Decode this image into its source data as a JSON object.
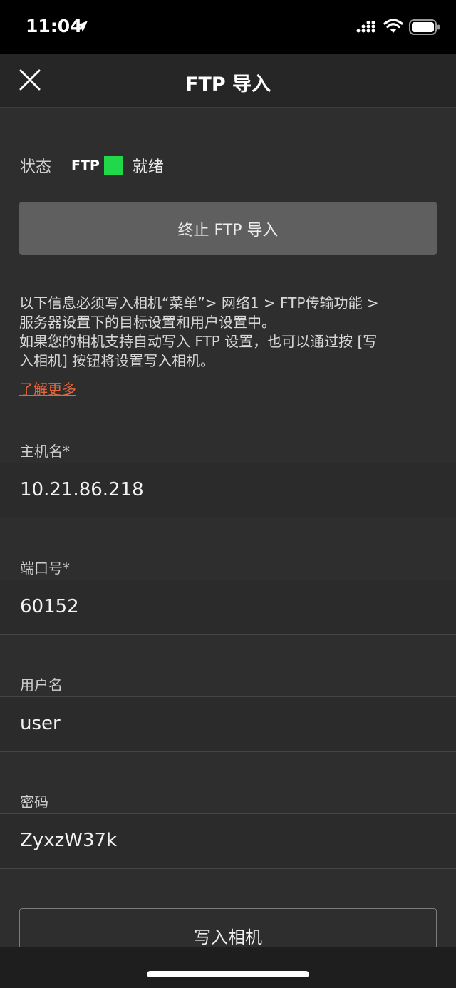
{
  "status_bar": {
    "time": "11:04",
    "icons": [
      "location-arrow-icon",
      "cellular-signal-icon",
      "wifi-icon",
      "battery-icon"
    ]
  },
  "nav": {
    "title": "FTP 导入",
    "close_icon": "close-icon"
  },
  "status": {
    "label": "状态",
    "ftp_tag": "FTP",
    "indicator_color": "#21d84a",
    "value": "就绪"
  },
  "stop_button": {
    "label": "终止 FTP 导入"
  },
  "info": {
    "line1": "以下信息必须写入相机“菜单”> 网络1 > FTP传输功能 >",
    "line2": "服务器设置下的目标设置和用户设置中。",
    "line3": "如果您的相机支持自动写入 FTP 设置，也可以通过按 [写",
    "line4": "入相机] 按钮将设置写入相机。",
    "learn_more": "了解更多",
    "link_color": "#e8643a"
  },
  "fields": [
    {
      "label": "主机名*",
      "value": "10.21.86.218"
    },
    {
      "label": "端口号*",
      "value": "60152"
    },
    {
      "label": "用户名",
      "value": "user"
    },
    {
      "label": "密码",
      "value": "ZyxzW37k"
    }
  ],
  "write_button": {
    "label": "写入相机"
  }
}
